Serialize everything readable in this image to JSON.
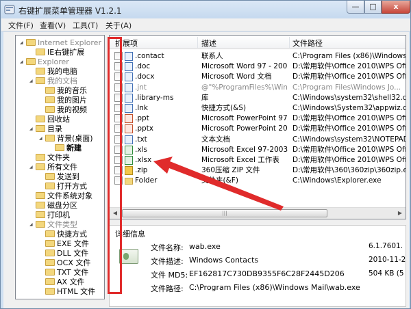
{
  "window": {
    "title": "右键扩展菜单管理器 V1.2.1",
    "controls": {
      "minimize": "—",
      "maximize": "□",
      "close": "x"
    }
  },
  "menu": [
    "文件(F)",
    "查看(V)",
    "工具(T)",
    "关于(A)"
  ],
  "tree": [
    {
      "label": "Internet Explorer",
      "level": 0,
      "twisty": "◢",
      "gray": true
    },
    {
      "label": "IE右键扩展",
      "level": 1,
      "twisty": "",
      "gray": false
    },
    {
      "label": "Explorer",
      "level": 0,
      "twisty": "◢",
      "gray": true
    },
    {
      "label": "我的电脑",
      "level": 1,
      "twisty": "",
      "gray": false
    },
    {
      "label": "我的文档",
      "level": 1,
      "twisty": "◢",
      "gray": true
    },
    {
      "label": "我的音乐",
      "level": 2,
      "twisty": "",
      "gray": false
    },
    {
      "label": "我的图片",
      "level": 2,
      "twisty": "",
      "gray": false
    },
    {
      "label": "我的视频",
      "level": 2,
      "twisty": "",
      "gray": false
    },
    {
      "label": "回收站",
      "level": 1,
      "twisty": "",
      "gray": false
    },
    {
      "label": "目录",
      "level": 1,
      "twisty": "◢",
      "gray": false
    },
    {
      "label": "背景(桌面)",
      "level": 2,
      "twisty": "◢",
      "gray": false
    },
    {
      "label": "新建",
      "level": 3,
      "twisty": "",
      "gray": false,
      "bold": true
    },
    {
      "label": "文件夹",
      "level": 1,
      "twisty": "",
      "gray": false
    },
    {
      "label": "所有文件",
      "level": 1,
      "twisty": "◢",
      "gray": false
    },
    {
      "label": "发送到",
      "level": 2,
      "twisty": "",
      "gray": false
    },
    {
      "label": "打开方式",
      "level": 2,
      "twisty": "",
      "gray": false
    },
    {
      "label": "文件系统对象",
      "level": 1,
      "twisty": "",
      "gray": false
    },
    {
      "label": "磁盘分区",
      "level": 1,
      "twisty": "",
      "gray": false
    },
    {
      "label": "打印机",
      "level": 1,
      "twisty": "",
      "gray": false
    },
    {
      "label": "文件类型",
      "level": 1,
      "twisty": "◢",
      "gray": true
    },
    {
      "label": "快捷方式",
      "level": 2,
      "twisty": "",
      "gray": false
    },
    {
      "label": "EXE 文件",
      "level": 2,
      "twisty": "",
      "gray": false
    },
    {
      "label": "DLL 文件",
      "level": 2,
      "twisty": "",
      "gray": false
    },
    {
      "label": "OCX 文件",
      "level": 2,
      "twisty": "",
      "gray": false
    },
    {
      "label": "TXT 文件",
      "level": 2,
      "twisty": "",
      "gray": false
    },
    {
      "label": "AX 文件",
      "level": 2,
      "twisty": "",
      "gray": false
    },
    {
      "label": "HTML 文件",
      "level": 2,
      "twisty": "",
      "gray": false
    }
  ],
  "list": {
    "columns": [
      "扩展项",
      "描述",
      "文件路径"
    ],
    "rows": [
      {
        "ext": ".contact",
        "desc": "联系人",
        "path": "C:\\Program Files (x86)\\Windows Mai...",
        "icon": "blue",
        "gray": false
      },
      {
        "ext": ".doc",
        "desc": "Microsoft Word 97 - 2003...",
        "path": "D:\\常用软件\\Office 2010\\WPS Offi...",
        "icon": "blue",
        "gray": false
      },
      {
        "ext": ".docx",
        "desc": "Microsoft Word 文档",
        "path": "D:\\常用软件\\Office 2010\\WPS Offi...",
        "icon": "blue",
        "gray": false
      },
      {
        "ext": ".jnt",
        "desc": "@\"%ProgramFiles%\\Win...",
        "path": "C:\\Program Files\\Windows Jo...",
        "icon": "blue",
        "gray": true
      },
      {
        "ext": ".library-ms",
        "desc": "库",
        "path": "C:\\Windows\\system32\\shell32.dll",
        "icon": "blue",
        "gray": false
      },
      {
        "ext": ".lnk",
        "desc": "快捷方式(&S)",
        "path": "C:\\Windows\\System32\\appwiz.cpl",
        "icon": "blue",
        "gray": false
      },
      {
        "ext": ".ppt",
        "desc": "Microsoft PowerPoint 97-...",
        "path": "D:\\常用软件\\Office 2010\\WPS Offi...",
        "icon": "red",
        "gray": false
      },
      {
        "ext": ".pptx",
        "desc": "Microsoft PowerPoint 200...",
        "path": "D:\\常用软件\\Office 2010\\WPS Offi...",
        "icon": "red",
        "gray": false
      },
      {
        "ext": ".txt",
        "desc": "文本文档",
        "path": "C:\\Windows\\system32\\NOTEPAD.EXE",
        "icon": "blue",
        "gray": false
      },
      {
        "ext": ".xls",
        "desc": "Microsoft Excel 97-2003 ...",
        "path": "D:\\常用软件\\Office 2010\\WPS Offi...",
        "icon": "green",
        "gray": false
      },
      {
        "ext": ".xlsx",
        "desc": "Microsoft Excel 工作表",
        "path": "D:\\常用软件\\Office 2010\\WPS Offi...",
        "icon": "green",
        "gray": false
      },
      {
        "ext": ".zip",
        "desc": "360压缩 ZIP 文件",
        "path": "D:\\常用软件\\360\\360zip\\360zip.exe",
        "icon": "zip",
        "gray": false
      },
      {
        "ext": "Folder",
        "desc": "文件夹(&F)",
        "path": "C:\\Windows\\Explorer.exe",
        "icon": "fold",
        "gray": false
      }
    ],
    "scroll_grip": "|||"
  },
  "detail": {
    "title": "详细信息",
    "fields": [
      {
        "label": "文件名称:",
        "value": "wab.exe",
        "extra": "6.1.7601."
      },
      {
        "label": "文件描述:",
        "value": "Windows Contacts",
        "extra": "2010-11-2"
      },
      {
        "label": "文件 MD5:",
        "value": "EF162817C730DB9355F6C28F2445D206",
        "extra": "504 KB (5"
      },
      {
        "label": "文件路径:",
        "value": "C:\\Program Files (x86)\\Windows Mail\\wab.exe",
        "extra": ""
      }
    ]
  },
  "colors": {
    "annotation": "#e02b2b",
    "frame": "#cfe0f2"
  }
}
